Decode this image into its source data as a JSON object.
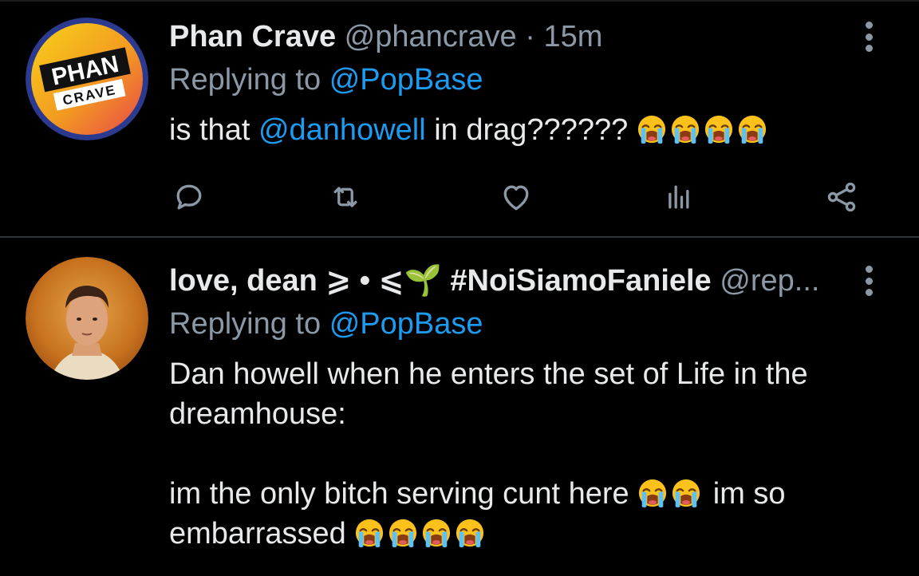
{
  "tweets": [
    {
      "avatar": {
        "label_top": "PHAN",
        "label_bottom": "CRAVE"
      },
      "display_name": "Phan Crave",
      "handle": "@phancrave",
      "separator": "·",
      "time": "15m",
      "replying_to_label": "Replying to",
      "replying_to_handle": "@PopBase",
      "text_before": "is that",
      "text_mention": "@danhowell",
      "text_after": "in drag??????",
      "emoji_count": 4,
      "emoji_name": "loudly-crying-face"
    },
    {
      "display_name": "love, dean ⩾ • ⩽🌱 #NoiSiamoFaniele",
      "handle": "@rep...",
      "replying_to_label": "Replying to",
      "replying_to_handle": "@PopBase",
      "line1": "Dan howell when he enters the set of Life in the dreamhouse:",
      "line2_before": "im the only bitch serving cunt here",
      "line2_after": "im so embarrassed",
      "emoji_name": "loudly-crying-face"
    }
  ],
  "icons": {
    "reply": "reply-icon",
    "retweet": "retweet-icon",
    "like": "like-icon",
    "stats": "stats-icon",
    "share": "share-icon",
    "more": "more-icon"
  },
  "colors": {
    "background": "#000000",
    "text": "#e7e9ea",
    "muted": "#8b98a5",
    "accent": "#1d9bf0",
    "divider": "#2f3336"
  }
}
